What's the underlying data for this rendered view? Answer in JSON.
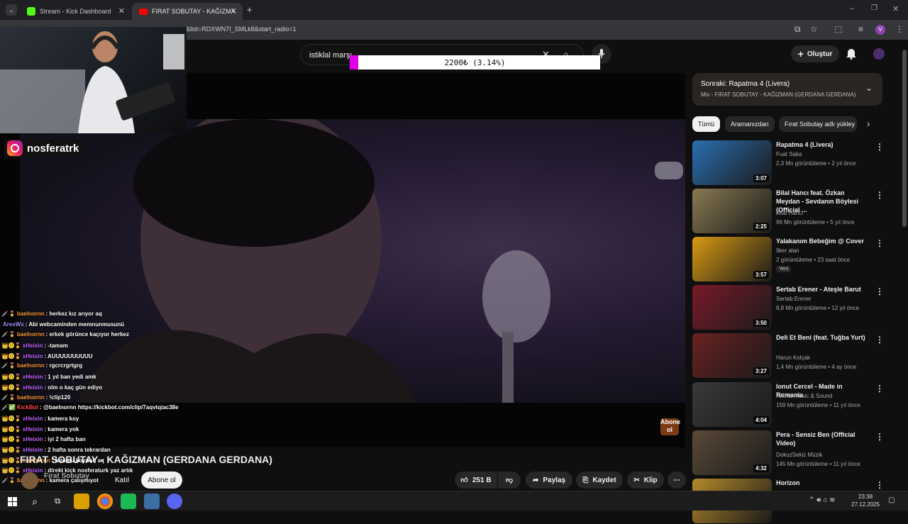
{
  "browser": {
    "tabs": [
      {
        "title": "Stream - Kick Dashboard"
      },
      {
        "title": "FIRAT SOBUTAY - KAĞIZMA"
      }
    ],
    "url": "&list=RDXWN7I_SMLk8&start_radio=1"
  },
  "youtube": {
    "search_value": "istiklal marşı",
    "create_label": "Oluştur",
    "goal_text": "2200₺ (3.14%)",
    "goal_fraction": 0.0314,
    "video_title": "FIRAT SOBUTAY - KAĞIZMAN (GERDANA GERDANA)",
    "watermark": "Abone ol",
    "channel_name": "Fırat Sobutay",
    "join_label": "Katıl",
    "subscribe_label": "Abone ol",
    "actions": {
      "likes": "251 B",
      "share": "Paylaş",
      "save": "Kaydet",
      "clip": "Klip"
    }
  },
  "overlay": {
    "instagram_handle": "nosferatrk",
    "chat": [
      {
        "user": "baelnornn",
        "color": "#ff9a3c",
        "text": "herkez kız arıyor aq",
        "badges": "🗡️🎖️"
      },
      {
        "user": "AresWx",
        "color": "#a78bfa",
        "text": "Abi webcaminden memnunmusunü",
        "badges": ""
      },
      {
        "user": "baelnornn",
        "color": "#ff9a3c",
        "text": "erkek görünce kaçıyor herkez",
        "badges": "🗡️🎖️"
      },
      {
        "user": "xHeixin",
        "color": "#c266ff",
        "text": "-tamam",
        "badges": "👑⓿🎖️"
      },
      {
        "user": "xHeixin",
        "color": "#c266ff",
        "text": "AUUUUUUUUUU",
        "badges": "👑⓿🎖️"
      },
      {
        "user": "baelnornn",
        "color": "#ff9a3c",
        "text": "rgcrcrgrtgrg",
        "badges": "🗡️🎖️"
      },
      {
        "user": "xHeixin",
        "color": "#c266ff",
        "text": "1 yıl ban yedi amk",
        "badges": "👑⓿🎖️"
      },
      {
        "user": "xHeixin",
        "color": "#c266ff",
        "text": "olm o kaç gün ediyo",
        "badges": "👑⓿🎖️"
      },
      {
        "user": "baelnornn",
        "color": "#ff9a3c",
        "text": "!clip120",
        "badges": "🗡️🎖️"
      },
      {
        "user": "KickBot",
        "color": "#ff4a4a",
        "text": "@baelnornn https://kickbot.com/clip/7aqvtqiac38e",
        "badges": "🗡️✅"
      },
      {
        "user": "xHeixin",
        "color": "#c266ff",
        "text": "kamera koy",
        "badges": "👑⓿🎖️"
      },
      {
        "user": "xHeixin",
        "color": "#c266ff",
        "text": "kamera yok",
        "badges": "👑⓿🎖️"
      },
      {
        "user": "xHeixin",
        "color": "#c266ff",
        "text": "iyi 2 hafta ban",
        "badges": "👑⓿🎖️"
      },
      {
        "user": "xHeixin",
        "color": "#c266ff",
        "text": "2 hafta sonra tekrardan",
        "badges": "👑⓿🎖️"
      },
      {
        "user": "baelnornn",
        "color": "#ff9a3c",
        "text": "fotomu koydun aq",
        "badges": "👑⓿🎖️"
      },
      {
        "user": "xHeixin",
        "color": "#c266ff",
        "text": "direkt kick nosferaturk yaz artık",
        "badges": "👑⓿🎖️"
      },
      {
        "user": "baelnornn",
        "color": "#ff9a3c",
        "text": "kamera çalışmıyot",
        "badges": "🗡️🎖️"
      }
    ]
  },
  "sidebar": {
    "next_label": "Sonraki: Rapatma 4 (Livera)",
    "next_sub": "Mix - FIRAT SOBUTAY - KAĞIZMAN (GERDANA GERDANA)",
    "chips": [
      "Tümü",
      "Aramanızdan",
      "Fırat Sobutay adlı yükley"
    ],
    "recs": [
      {
        "title": "Rapatma 4 (Livera)",
        "channel": "Fuat Saka",
        "meta": "2,3 Mn görüntüleme • 2 yıl önce",
        "duration": "3:07",
        "color": "#2a6fb0"
      },
      {
        "title": "Bilal Hancı feat. Özkan Meydan - Sevdanın Böylesi (Official ...",
        "channel": "Bilal Hancı",
        "meta": "96 Mn görüntüleme • 5 yıl önce",
        "duration": "2:25",
        "color": "#8a7a52"
      },
      {
        "title": "Yalakanım Bebeğim @ Cover",
        "channel": "İlker alan",
        "meta": "2 görüntüleme • 23 saat önce",
        "duration": "3:57",
        "color": "#d89a12",
        "badge": "Yeni"
      },
      {
        "title": "Sertab Erener - Ateşle Barut",
        "channel": "Sertab Erener",
        "meta": "8,8 Mn görüntüleme • 12 yıl önce",
        "duration": "3:50",
        "color": "#7a1a2a"
      },
      {
        "title": "Deli Et Beni (feat. Tuğba Yurt)",
        "channel": "Harun Kolçak",
        "meta": "1,4 Mn görüntüleme • 4 ay önce",
        "duration": "3:27",
        "color": "#6a2222"
      },
      {
        "title": "Ionut Cercel - Made in Romania",
        "channel": "Amma Music & Sound",
        "meta": "159 Mn görüntüleme • 11 yıl önce",
        "duration": "4:04",
        "color": "#3a3a3a"
      },
      {
        "title": "Pera - Sensiz Ben (Official Video)",
        "channel": "DokuzSekiz Müzik",
        "meta": "145 Mn görüntüleme • 11 yıl önce",
        "duration": "4:32",
        "color": "#5a4a38"
      },
      {
        "title": "Horizon",
        "channel": "",
        "meta": "",
        "duration": "",
        "color": "#b58a2a"
      }
    ]
  },
  "taskbar": {
    "time": "23:38",
    "date": "27.12.2025"
  }
}
